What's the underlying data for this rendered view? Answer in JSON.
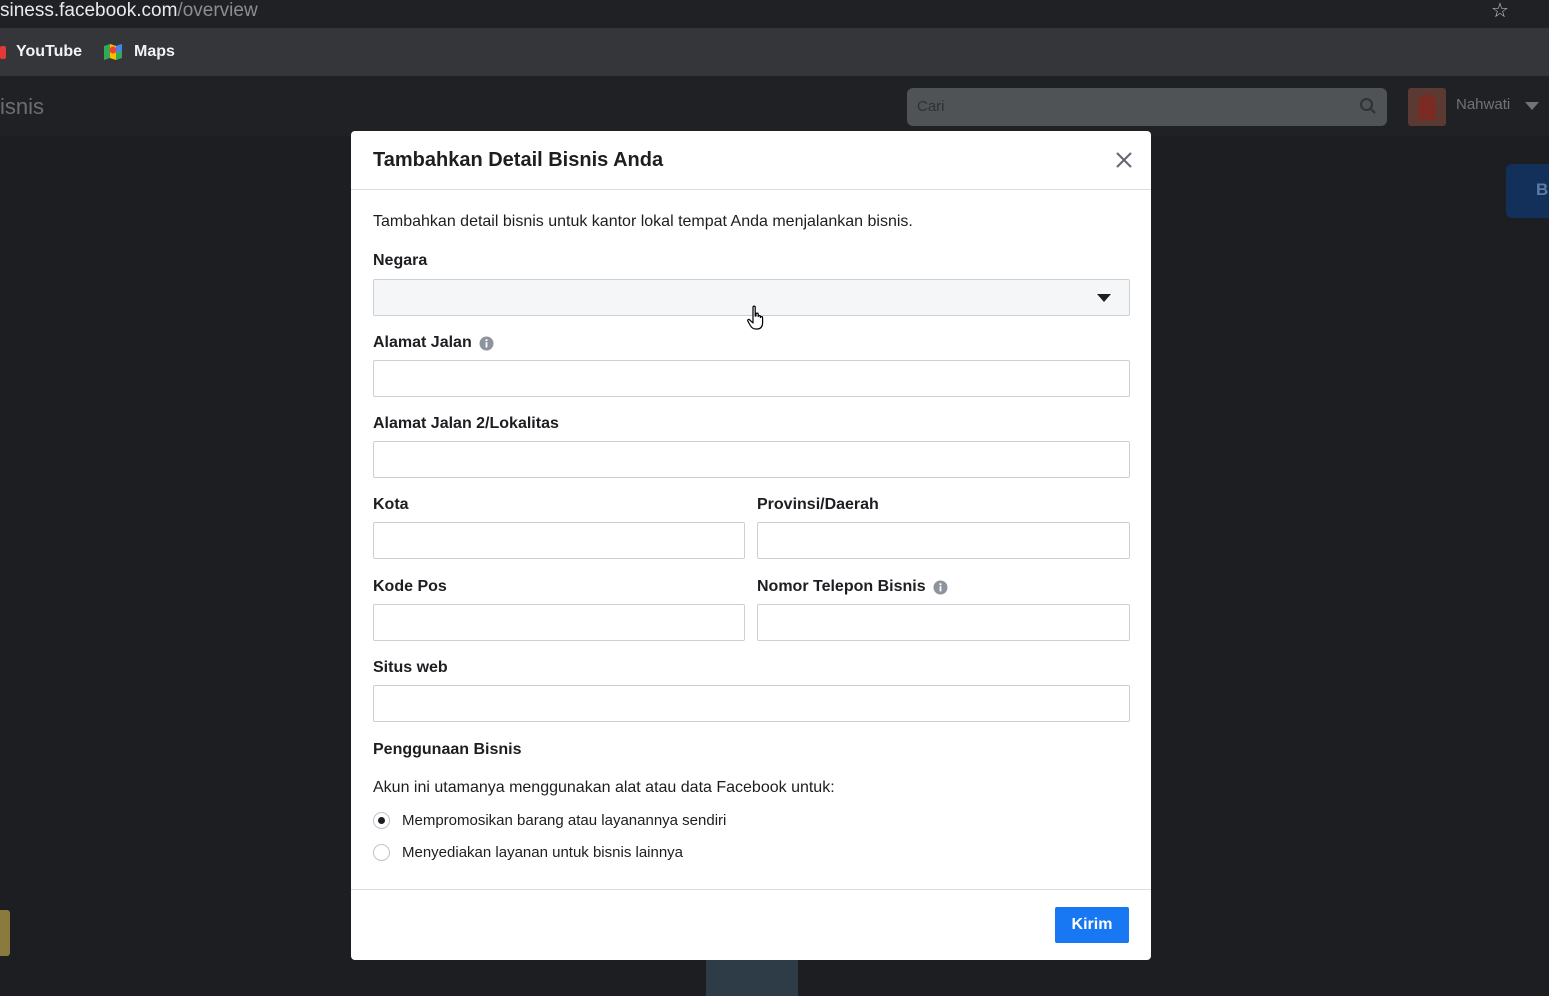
{
  "browser": {
    "url_host": "siness.facebook.com",
    "url_path": "/overview",
    "bookmarks": [
      {
        "label": "YouTube",
        "icon": "youtube-icon"
      },
      {
        "label": "Maps",
        "icon": "maps-icon"
      }
    ]
  },
  "header": {
    "page_title": "isnis",
    "search_placeholder": "Cari",
    "user_name": "Nahwati",
    "side_button_letter": "B"
  },
  "modal": {
    "title": "Tambahkan Detail Bisnis Anda",
    "intro": "Tambahkan detail bisnis untuk kantor lokal tempat Anda menjalankan bisnis.",
    "fields": {
      "country": {
        "label": "Negara",
        "value": ""
      },
      "street": {
        "label": "Alamat Jalan",
        "value": ""
      },
      "street2": {
        "label": "Alamat Jalan 2/Lokalitas",
        "value": ""
      },
      "city": {
        "label": "Kota",
        "value": ""
      },
      "province": {
        "label": "Provinsi/Daerah",
        "value": ""
      },
      "postal": {
        "label": "Kode Pos",
        "value": ""
      },
      "phone": {
        "label": "Nomor Telepon Bisnis",
        "value": ""
      },
      "website": {
        "label": "Situs web",
        "value": ""
      }
    },
    "usage": {
      "title": "Penggunaan Bisnis",
      "description": "Akun ini utamanya menggunakan alat atau data Facebook untuk:",
      "options": [
        {
          "label": "Mempromosikan barang atau layanannya sendiri",
          "selected": true
        },
        {
          "label": "Menyediakan layanan untuk bisnis lainnya",
          "selected": false
        }
      ]
    },
    "submit_label": "Kirim"
  },
  "colors": {
    "primary": "#1877f2",
    "overlay": "#1c1e21"
  }
}
